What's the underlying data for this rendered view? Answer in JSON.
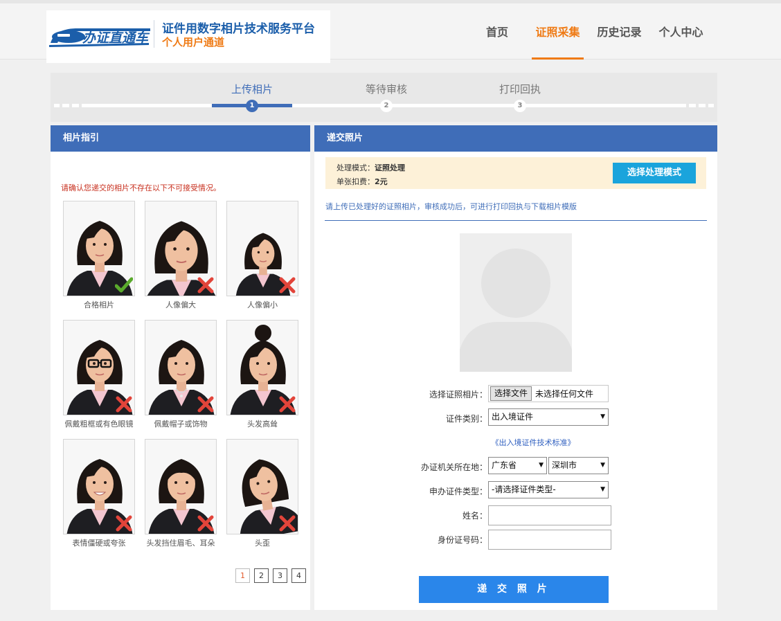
{
  "header": {
    "logo_text": "办证直通车",
    "title": "证件用数字相片技术服务平台",
    "subtitle": "个人用户通道",
    "nav": [
      {
        "label": "首页",
        "active": false
      },
      {
        "label": "证照采集",
        "active": true
      },
      {
        "label": "历史记录",
        "active": false
      },
      {
        "label": "个人中心",
        "active": false
      }
    ]
  },
  "steps": [
    {
      "label": "上传相片",
      "number": "1",
      "active": true
    },
    {
      "label": "等待审核",
      "number": "2",
      "active": false
    },
    {
      "label": "打印回执",
      "number": "3",
      "active": false
    }
  ],
  "guide": {
    "heading": "相片指引",
    "note": "请确认您递交的相片不存在以下不可接受情况。",
    "photos": [
      {
        "caption": "合格相片",
        "status": "check-icon"
      },
      {
        "caption": "人像偏大",
        "status": "cross-icon"
      },
      {
        "caption": "人像偏小",
        "status": "cross-icon"
      },
      {
        "caption": "佩戴粗框或有色眼镜",
        "status": "cross-icon"
      },
      {
        "caption": "佩戴帽子或饰物",
        "status": "cross-icon"
      },
      {
        "caption": "头发高耸",
        "status": "cross-icon"
      },
      {
        "caption": "表情僵硬或夸张",
        "status": "cross-icon"
      },
      {
        "caption": "头发挡住眉毛、耳朵",
        "status": "cross-icon"
      },
      {
        "caption": "头歪",
        "status": "cross-icon"
      }
    ],
    "pages": [
      "1",
      "2",
      "3",
      "4"
    ],
    "current_page": "1"
  },
  "submit_panel": {
    "heading": "递交照片",
    "mode_label": "处理模式：",
    "mode_value": "证照处理",
    "fee_label": "单张扣费：",
    "fee_value": "2元",
    "mode_button": "选择处理模式",
    "hint": "请上传已处理好的证照相片，审核成功后，可进行打印回执与下载相片模版",
    "form": {
      "photo_label": "选择证照相片：",
      "file_button": "选择文件",
      "file_status": "未选择任何文件",
      "doc_type_label": "证件类别：",
      "doc_type_value": "出入境证件",
      "standard_link": "《出入境证件技术标准》",
      "location_label": "办证机关所在地：",
      "province_value": "广东省",
      "city_value": "深圳市",
      "apply_type_label": "申办证件类型：",
      "apply_type_value": "-请选择证件类型-",
      "name_label": "姓名：",
      "id_label": "身份证号码："
    },
    "submit_button": "递 交 照 片"
  },
  "colors": {
    "primary": "#3f6db8",
    "accent": "#ef7a14",
    "submit": "#2a86ea",
    "mode_button": "#1aa4dc",
    "warning_text": "#c8301f"
  }
}
